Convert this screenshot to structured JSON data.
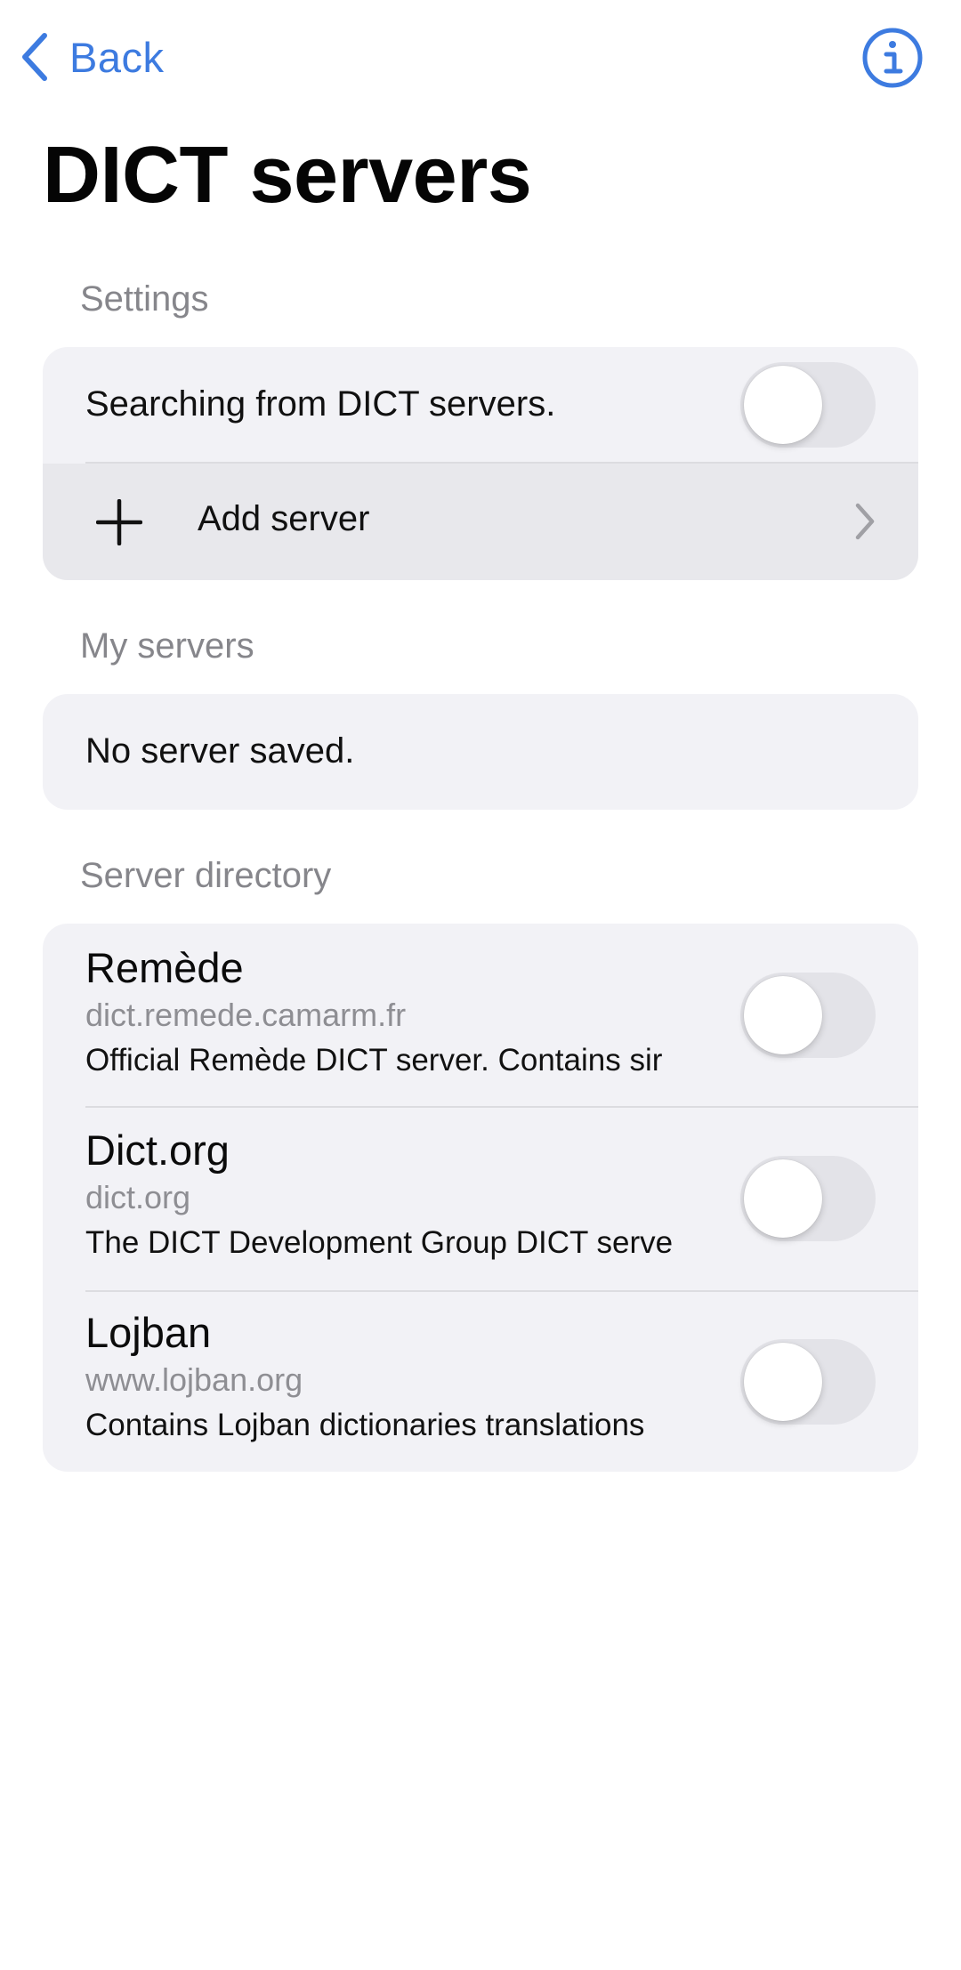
{
  "nav": {
    "back_label": "Back",
    "back_icon": "chevron-left-icon",
    "info_icon": "info-circle-icon",
    "accent_color": "#3d7be0"
  },
  "page": {
    "title": "DICT servers"
  },
  "settings": {
    "section_label": "Settings",
    "search_toggle_label": "Searching from DICT servers.",
    "search_toggle_on": false,
    "add_server_label": "Add server",
    "add_icon": "plus-icon",
    "chevron_icon": "chevron-right-icon"
  },
  "my_servers": {
    "section_label": "My servers",
    "empty_text": "No server saved."
  },
  "directory": {
    "section_label": "Server directory",
    "servers": [
      {
        "name": "Remède",
        "host": "dict.remede.camarm.fr",
        "description": "Official Remède DICT server. Contains sir",
        "enabled": false
      },
      {
        "name": "Dict.org",
        "host": "dict.org",
        "description": "The DICT Development Group DICT serve",
        "enabled": false
      },
      {
        "name": "Lojban",
        "host": "www.lojban.org",
        "description": "Contains Lojban dictionaries translations",
        "enabled": false
      }
    ]
  }
}
